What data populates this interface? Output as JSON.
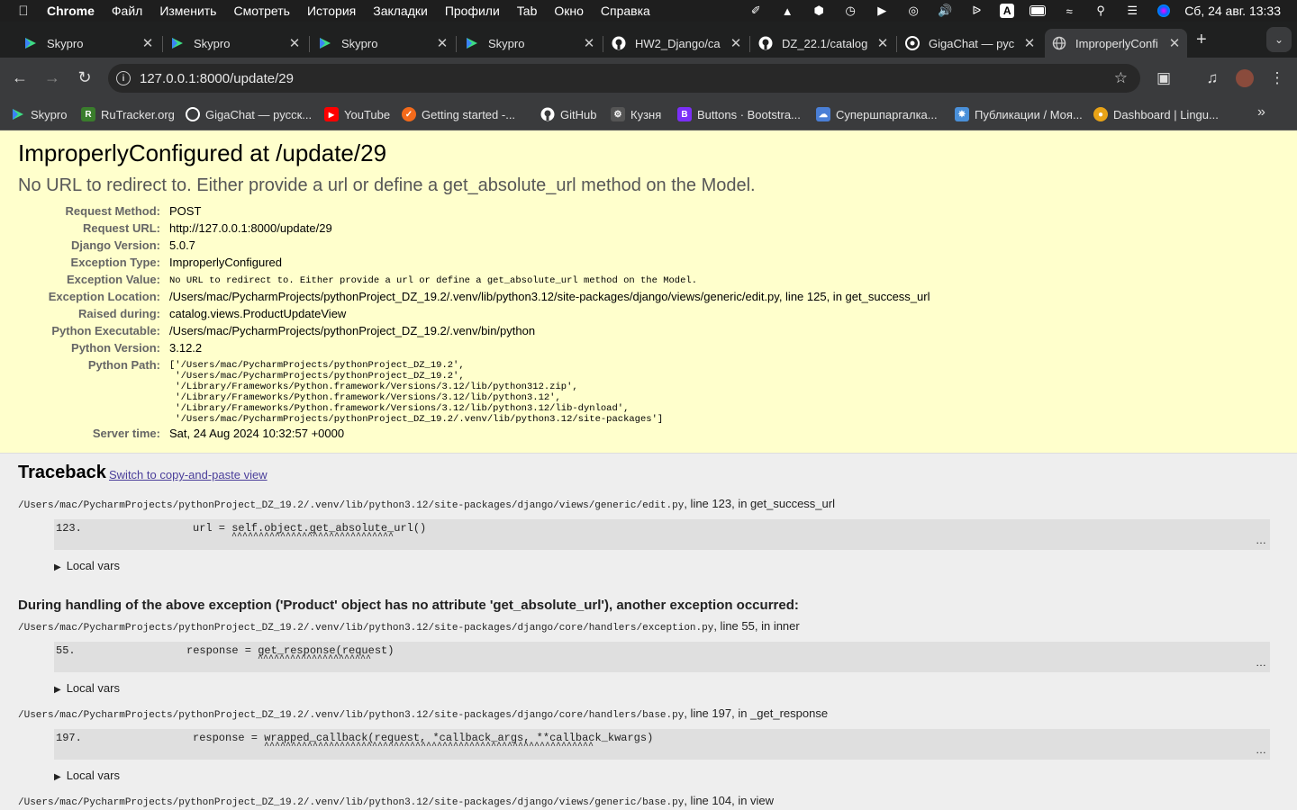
{
  "menubar": {
    "app": "Chrome",
    "items": [
      "Файл",
      "Изменить",
      "Смотреть",
      "История",
      "Закладки",
      "Профили",
      "Tab",
      "Окно",
      "Справка"
    ],
    "clock": "Сб, 24 авг.  13:33"
  },
  "tabs": [
    {
      "title": "Skypro"
    },
    {
      "title": "Skypro"
    },
    {
      "title": "Skypro"
    },
    {
      "title": "Skypro"
    },
    {
      "title": "HW2_Django/ca"
    },
    {
      "title": "DZ_22.1/catalog"
    },
    {
      "title": "GigaChat — рус"
    },
    {
      "title": "ImproperlyConfi"
    }
  ],
  "address": {
    "url": "127.0.0.1:8000/update/29"
  },
  "bookmarks": [
    {
      "label": "Skypro",
      "color": "#1cc45d"
    },
    {
      "label": "RuTracker.org",
      "color": "#3a7d2c"
    },
    {
      "label": "GigaChat — русск...",
      "color": "#2a2a2a"
    },
    {
      "label": "YouTube",
      "color": "#ff0000"
    },
    {
      "label": "Getting started -...",
      "color": "#f46a1b"
    },
    {
      "label": "GitHub",
      "color": "#2a2a2a"
    },
    {
      "label": "Кузня",
      "color": "#555555"
    },
    {
      "label": "Buttons · Bootstra...",
      "color": "#7b2ff7"
    },
    {
      "label": "Супершпаргалка...",
      "color": "#4a7fd6"
    },
    {
      "label": "Публикации / Моя...",
      "color": "#4a90d9"
    },
    {
      "label": "Dashboard | Lingu...",
      "color": "#e8a317"
    }
  ],
  "summary": {
    "title": "ImproperlyConfigured at /update/29",
    "exception_value": "No URL to redirect to.  Either provide a url or define a get_absolute_url method on the Model.",
    "rows": [
      {
        "key": "Request Method:",
        "value": "POST"
      },
      {
        "key": "Request URL:",
        "value": "http://127.0.0.1:8000/update/29"
      },
      {
        "key": "Django Version:",
        "value": "5.0.7"
      },
      {
        "key": "Exception Type:",
        "value": "ImproperlyConfigured"
      },
      {
        "key": "Exception Value:",
        "value": "No URL to redirect to.  Either provide a url or define a get_absolute_url method on the Model."
      },
      {
        "key": "Exception Location:",
        "value": "/Users/mac/PycharmProjects/pythonProject_DZ_19.2/.venv/lib/python3.12/site-packages/django/views/generic/edit.py, line 125, in get_success_url"
      },
      {
        "key": "Raised during:",
        "value": "catalog.views.ProductUpdateView"
      },
      {
        "key": "Python Executable:",
        "value": "/Users/mac/PycharmProjects/pythonProject_DZ_19.2/.venv/bin/python"
      },
      {
        "key": "Python Version:",
        "value": "3.12.2"
      },
      {
        "key": "Python Path:",
        "value": ""
      },
      {
        "key": "Server time:",
        "value": "Sat, 24 Aug 2024 10:32:57 +0000"
      }
    ],
    "python_path": "['/Users/mac/PycharmProjects/pythonProject_DZ_19.2',\n '/Users/mac/PycharmProjects/pythonProject_DZ_19.2',\n '/Library/Frameworks/Python.framework/Versions/3.12/lib/python312.zip',\n '/Library/Frameworks/Python.framework/Versions/3.12/lib/python3.12',\n '/Library/Frameworks/Python.framework/Versions/3.12/lib/python3.12/lib-dynload',\n '/Users/mac/PycharmProjects/pythonProject_DZ_19.2/.venv/lib/python3.12/site-packages']"
  },
  "traceback": {
    "heading": "Traceback",
    "switch_link": "Switch to copy-and-paste view",
    "during": "During handling of the above exception ('Product' object has no attribute 'get_absolute_url'), another exception occurred:",
    "local_vars": "Local vars",
    "frames": [
      {
        "path": "/Users/mac/PycharmProjects/pythonProject_DZ_19.2/.venv/lib/python3.12/site-packages/django/views/generic/edit.py",
        "where": ", line 123, in get_success_url",
        "line_no": "123.",
        "code": "url = self.object.get_absolute_url()",
        "carets": "^^^^^^^^^^^^^^^^^^^^^^^^^^^^^^",
        "dots": "…"
      },
      {
        "path": "/Users/mac/PycharmProjects/pythonProject_DZ_19.2/.venv/lib/python3.12/site-packages/django/core/handlers/exception.py",
        "where": ", line 55, in inner",
        "line_no": "55.",
        "code": "response = get_response(request)",
        "carets": "^^^^^^^^^^^^^^^^^^^^^",
        "dots": "…"
      },
      {
        "path": "/Users/mac/PycharmProjects/pythonProject_DZ_19.2/.venv/lib/python3.12/site-packages/django/core/handlers/base.py",
        "where": ", line 197, in _get_response",
        "line_no": "197.",
        "code": "response = wrapped_callback(request, *callback_args, **callback_kwargs)",
        "carets": "^^^^^^^^^^^^^^^^^^^^^^^^^^^^^^^^^^^^^^^^^^^^^^^^^^^^^^^^^^^^^",
        "dots": "…"
      },
      {
        "path": "/Users/mac/PycharmProjects/pythonProject_DZ_19.2/.venv/lib/python3.12/site-packages/django/views/generic/base.py",
        "where": ", line 104, in view"
      }
    ]
  }
}
